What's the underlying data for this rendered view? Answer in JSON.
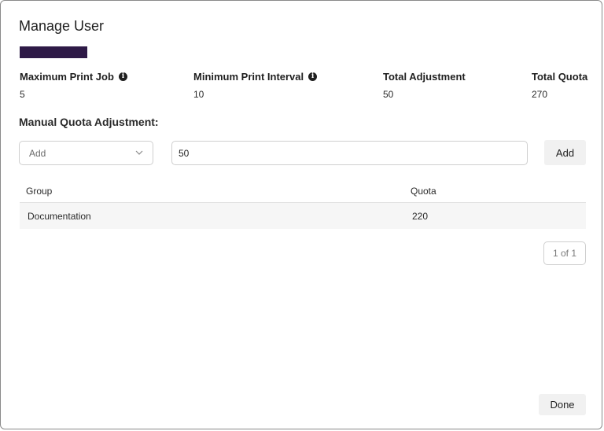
{
  "dialog": {
    "title": "Manage User",
    "redaction_color": "#2e1a47"
  },
  "stats": [
    {
      "label": "Maximum Print Job",
      "value": "5",
      "has_info": true
    },
    {
      "label": "Minimum Print Interval",
      "value": "10",
      "has_info": true
    },
    {
      "label": "Total Adjustment",
      "value": "50",
      "has_info": false
    },
    {
      "label": "Total Quota",
      "value": "270",
      "has_info": false
    }
  ],
  "adjustment": {
    "section_label": "Manual Quota Adjustment:",
    "action_selected": "Add",
    "amount_value": "50",
    "add_button_label": "Add"
  },
  "table": {
    "columns": [
      "Group",
      "Quota"
    ],
    "rows": [
      {
        "group": "Documentation",
        "quota": "220"
      }
    ]
  },
  "pagination": {
    "label": "1 of 1"
  },
  "footer": {
    "done_label": "Done"
  },
  "icons": {
    "info": "info-icon",
    "select_chevron": "chevron-down-icon"
  }
}
